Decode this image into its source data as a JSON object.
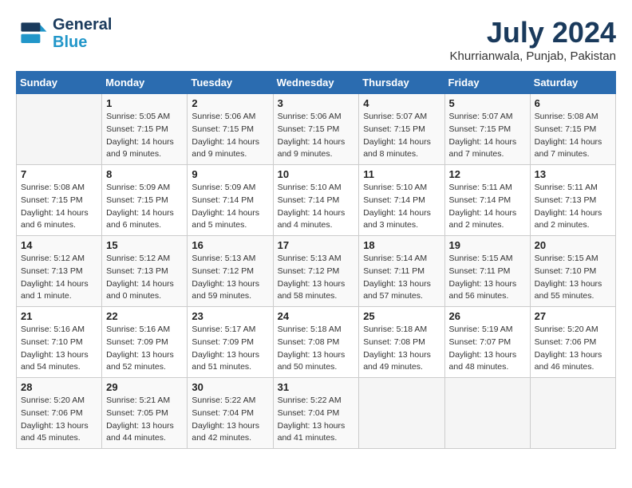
{
  "header": {
    "logo_line1": "General",
    "logo_line2": "Blue",
    "month_title": "July 2024",
    "location": "Khurrianwala, Punjab, Pakistan"
  },
  "weekdays": [
    "Sunday",
    "Monday",
    "Tuesday",
    "Wednesday",
    "Thursday",
    "Friday",
    "Saturday"
  ],
  "weeks": [
    [
      {
        "day": "",
        "info": ""
      },
      {
        "day": "1",
        "info": "Sunrise: 5:05 AM\nSunset: 7:15 PM\nDaylight: 14 hours\nand 9 minutes."
      },
      {
        "day": "2",
        "info": "Sunrise: 5:06 AM\nSunset: 7:15 PM\nDaylight: 14 hours\nand 9 minutes."
      },
      {
        "day": "3",
        "info": "Sunrise: 5:06 AM\nSunset: 7:15 PM\nDaylight: 14 hours\nand 9 minutes."
      },
      {
        "day": "4",
        "info": "Sunrise: 5:07 AM\nSunset: 7:15 PM\nDaylight: 14 hours\nand 8 minutes."
      },
      {
        "day": "5",
        "info": "Sunrise: 5:07 AM\nSunset: 7:15 PM\nDaylight: 14 hours\nand 7 minutes."
      },
      {
        "day": "6",
        "info": "Sunrise: 5:08 AM\nSunset: 7:15 PM\nDaylight: 14 hours\nand 7 minutes."
      }
    ],
    [
      {
        "day": "7",
        "info": "Sunrise: 5:08 AM\nSunset: 7:15 PM\nDaylight: 14 hours\nand 6 minutes."
      },
      {
        "day": "8",
        "info": "Sunrise: 5:09 AM\nSunset: 7:15 PM\nDaylight: 14 hours\nand 6 minutes."
      },
      {
        "day": "9",
        "info": "Sunrise: 5:09 AM\nSunset: 7:14 PM\nDaylight: 14 hours\nand 5 minutes."
      },
      {
        "day": "10",
        "info": "Sunrise: 5:10 AM\nSunset: 7:14 PM\nDaylight: 14 hours\nand 4 minutes."
      },
      {
        "day": "11",
        "info": "Sunrise: 5:10 AM\nSunset: 7:14 PM\nDaylight: 14 hours\nand 3 minutes."
      },
      {
        "day": "12",
        "info": "Sunrise: 5:11 AM\nSunset: 7:14 PM\nDaylight: 14 hours\nand 2 minutes."
      },
      {
        "day": "13",
        "info": "Sunrise: 5:11 AM\nSunset: 7:13 PM\nDaylight: 14 hours\nand 2 minutes."
      }
    ],
    [
      {
        "day": "14",
        "info": "Sunrise: 5:12 AM\nSunset: 7:13 PM\nDaylight: 14 hours\nand 1 minute."
      },
      {
        "day": "15",
        "info": "Sunrise: 5:12 AM\nSunset: 7:13 PM\nDaylight: 14 hours\nand 0 minutes."
      },
      {
        "day": "16",
        "info": "Sunrise: 5:13 AM\nSunset: 7:12 PM\nDaylight: 13 hours\nand 59 minutes."
      },
      {
        "day": "17",
        "info": "Sunrise: 5:13 AM\nSunset: 7:12 PM\nDaylight: 13 hours\nand 58 minutes."
      },
      {
        "day": "18",
        "info": "Sunrise: 5:14 AM\nSunset: 7:11 PM\nDaylight: 13 hours\nand 57 minutes."
      },
      {
        "day": "19",
        "info": "Sunrise: 5:15 AM\nSunset: 7:11 PM\nDaylight: 13 hours\nand 56 minutes."
      },
      {
        "day": "20",
        "info": "Sunrise: 5:15 AM\nSunset: 7:10 PM\nDaylight: 13 hours\nand 55 minutes."
      }
    ],
    [
      {
        "day": "21",
        "info": "Sunrise: 5:16 AM\nSunset: 7:10 PM\nDaylight: 13 hours\nand 54 minutes."
      },
      {
        "day": "22",
        "info": "Sunrise: 5:16 AM\nSunset: 7:09 PM\nDaylight: 13 hours\nand 52 minutes."
      },
      {
        "day": "23",
        "info": "Sunrise: 5:17 AM\nSunset: 7:09 PM\nDaylight: 13 hours\nand 51 minutes."
      },
      {
        "day": "24",
        "info": "Sunrise: 5:18 AM\nSunset: 7:08 PM\nDaylight: 13 hours\nand 50 minutes."
      },
      {
        "day": "25",
        "info": "Sunrise: 5:18 AM\nSunset: 7:08 PM\nDaylight: 13 hours\nand 49 minutes."
      },
      {
        "day": "26",
        "info": "Sunrise: 5:19 AM\nSunset: 7:07 PM\nDaylight: 13 hours\nand 48 minutes."
      },
      {
        "day": "27",
        "info": "Sunrise: 5:20 AM\nSunset: 7:06 PM\nDaylight: 13 hours\nand 46 minutes."
      }
    ],
    [
      {
        "day": "28",
        "info": "Sunrise: 5:20 AM\nSunset: 7:06 PM\nDaylight: 13 hours\nand 45 minutes."
      },
      {
        "day": "29",
        "info": "Sunrise: 5:21 AM\nSunset: 7:05 PM\nDaylight: 13 hours\nand 44 minutes."
      },
      {
        "day": "30",
        "info": "Sunrise: 5:22 AM\nSunset: 7:04 PM\nDaylight: 13 hours\nand 42 minutes."
      },
      {
        "day": "31",
        "info": "Sunrise: 5:22 AM\nSunset: 7:04 PM\nDaylight: 13 hours\nand 41 minutes."
      },
      {
        "day": "",
        "info": ""
      },
      {
        "day": "",
        "info": ""
      },
      {
        "day": "",
        "info": ""
      }
    ]
  ]
}
